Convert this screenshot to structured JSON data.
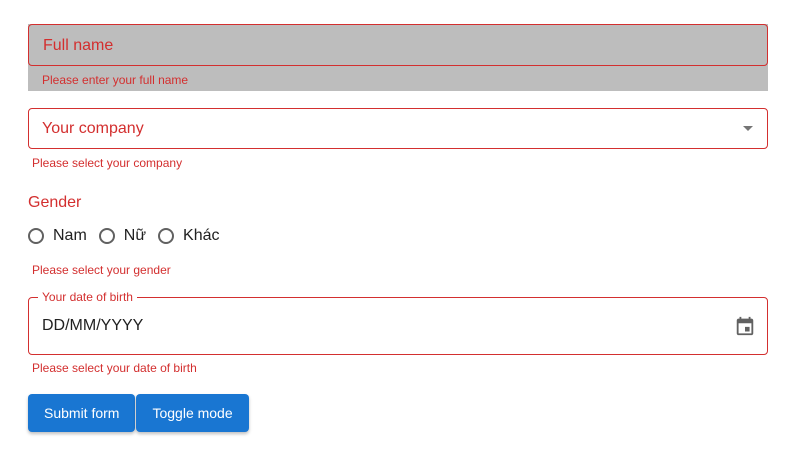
{
  "form": {
    "full_name": {
      "label": "Full name",
      "helper": "Please enter your full name"
    },
    "company": {
      "label": "Your company",
      "helper": "Please select your company",
      "icon": "arrow-drop-down-icon"
    },
    "gender": {
      "label": "Gender",
      "options": [
        "Nam",
        "Nữ",
        "Khác"
      ],
      "helper": "Please select your gender"
    },
    "dob": {
      "label": "Your date of birth",
      "placeholder": "DD/MM/YYYY",
      "helper": "Please select your date of birth",
      "icon": "calendar-icon"
    },
    "buttons": {
      "submit": "Submit form",
      "toggle": "Toggle mode"
    }
  },
  "colors": {
    "error": "#d32f2f",
    "primary": "#1976d2",
    "filled_bg": "#bdbdbd"
  }
}
